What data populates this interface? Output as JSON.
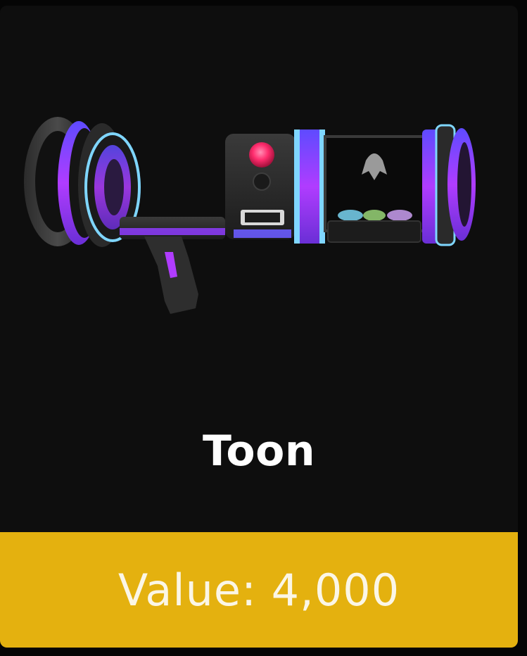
{
  "item": {
    "name": "Toon",
    "image_icon": "toon-blaster-icon",
    "value_label": "Value: 4,000"
  },
  "colors": {
    "card_background": "#0e0e0e",
    "value_bar": "#e4b10f",
    "name_text": "#ffffff",
    "value_text": "#fbf6e6",
    "accent_purple": "#b03cff",
    "accent_blue": "#6a5cff",
    "accent_red_light": "#ff2d6e"
  }
}
